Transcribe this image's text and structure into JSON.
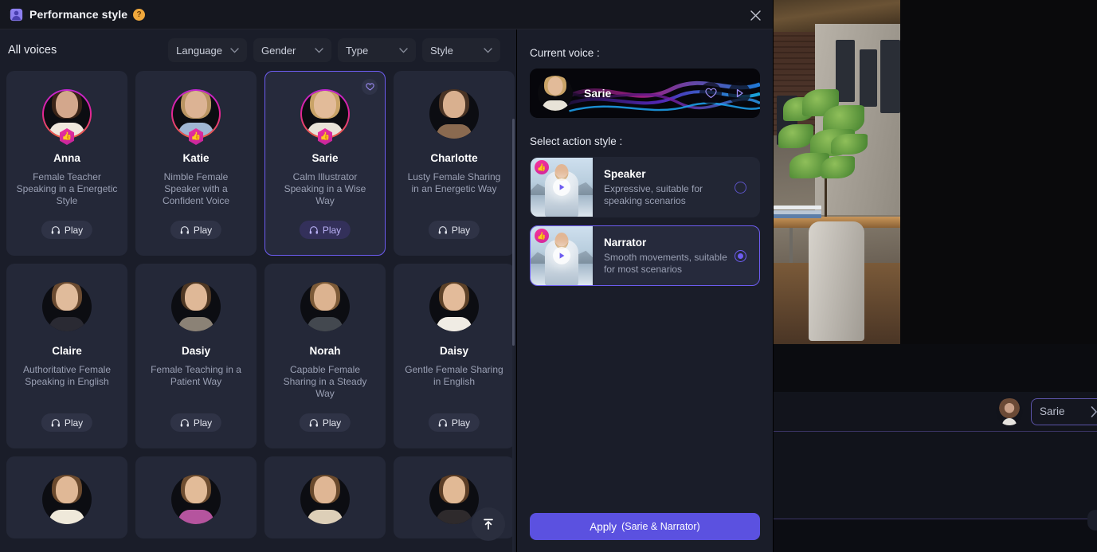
{
  "window": {
    "title": "Performance style",
    "title_icon": "avatar-person-icon",
    "help_badge": "?",
    "close_icon": "close-icon"
  },
  "left_pane": {
    "section_label": "All voices",
    "filters": [
      {
        "label": "Language",
        "icon": "chevron-down-icon"
      },
      {
        "label": "Gender",
        "icon": "chevron-down-icon"
      },
      {
        "label": "Type",
        "icon": "chevron-down-icon"
      },
      {
        "label": "Style",
        "icon": "chevron-down-icon"
      }
    ],
    "play_label": "Play",
    "play_icon": "headphones-icon",
    "favorite_icon": "heart-icon",
    "badge_icon": "thumbs-up-icon",
    "scroll_top_icon": "scroll-to-top-icon",
    "voices": [
      {
        "name": "Anna",
        "desc": "Female Teacher Speaking in a Energetic Style",
        "selected": false,
        "ring": true,
        "badge": true,
        "skin": "#d3a78c",
        "hair": "#3a2418",
        "cloth": "#efe7dd"
      },
      {
        "name": "Katie",
        "desc": "Nimble Female Speaker with a Confident Voice",
        "selected": false,
        "ring": true,
        "badge": true,
        "skin": "#dcb394",
        "hair": "#b99462",
        "cloth": "#9fb6d3"
      },
      {
        "name": "Sarie",
        "desc": "Calm Illustrator Speaking in a Wise Way",
        "selected": true,
        "ring": true,
        "badge": true,
        "skin": "#e2bb99",
        "hair": "#c9a367",
        "cloth": "#e8e3d8"
      },
      {
        "name": "Charlotte",
        "desc": "Lusty Female Sharing in an Energetic Way",
        "selected": false,
        "ring": false,
        "badge": false,
        "skin": "#d9b08f",
        "hair": "#4a3425",
        "cloth": "#8a6a50"
      },
      {
        "name": "Claire",
        "desc": "Authoritative Female Speaking in English",
        "selected": false,
        "ring": false,
        "badge": false,
        "skin": "#e0bb9b",
        "hair": "#6b4b31",
        "cloth": "#2a2a33"
      },
      {
        "name": "Dasiy",
        "desc": "Female Teaching in a Patient Way",
        "selected": false,
        "ring": false,
        "badge": false,
        "skin": "#dfb897",
        "hair": "#4f3824",
        "cloth": "#8b8276"
      },
      {
        "name": "Norah",
        "desc": "Capable Female Sharing in a Steady Way",
        "selected": false,
        "ring": false,
        "badge": false,
        "skin": "#dcb390",
        "hair": "#7d5b38",
        "cloth": "#43484f"
      },
      {
        "name": "Daisy",
        "desc": "Gentle Female Sharing in English",
        "selected": false,
        "ring": false,
        "badge": false,
        "skin": "#e3bb9a",
        "hair": "#5e4228",
        "cloth": "#f0ece4"
      }
    ],
    "voices_partial": [
      {
        "name": "",
        "desc": "",
        "skin": "#e0b896",
        "hair": "#6b4a2e",
        "cloth": "#efe9da"
      },
      {
        "name": "",
        "desc": "",
        "skin": "#e2bb98",
        "hair": "#6f4e31",
        "cloth": "#b5549e"
      },
      {
        "name": "",
        "desc": "",
        "skin": "#dfb694",
        "hair": "#6a4a2d",
        "cloth": "#ddcfb8"
      },
      {
        "name": "",
        "desc": "",
        "skin": "#e1b995",
        "hair": "#5c3e26",
        "cloth": "#2e2a2c"
      }
    ]
  },
  "right_pane": {
    "current_voice_label": "Current voice :",
    "current_voice_name": "Sarie",
    "current_voice_favorite_icon": "heart-icon",
    "current_voice_play_icon": "play-icon",
    "action_style_label": "Select action style :",
    "styles": [
      {
        "title": "Speaker",
        "desc": "Expressive, suitable for speaking scenarios",
        "selected": false,
        "badge_icon": "thumbs-up-icon",
        "play_icon": "play-icon"
      },
      {
        "title": "Narrator",
        "desc": "Smooth movements, suitable for most scenarios",
        "selected": true,
        "badge_icon": "thumbs-up-icon",
        "play_icon": "play-icon"
      }
    ],
    "apply_label": "Apply",
    "apply_detail": "(Sarie & Narrator)"
  },
  "background": {
    "voice_chip_label": "Sarie",
    "voice_chip_icon": "chevron-right-icon"
  },
  "colors": {
    "accent": "#6d5cf0",
    "apply": "#5b51e0",
    "panel": "#1a1d29",
    "card": "#242838",
    "badge_pink": "#f0309f",
    "help_orange": "#f0a83c"
  }
}
